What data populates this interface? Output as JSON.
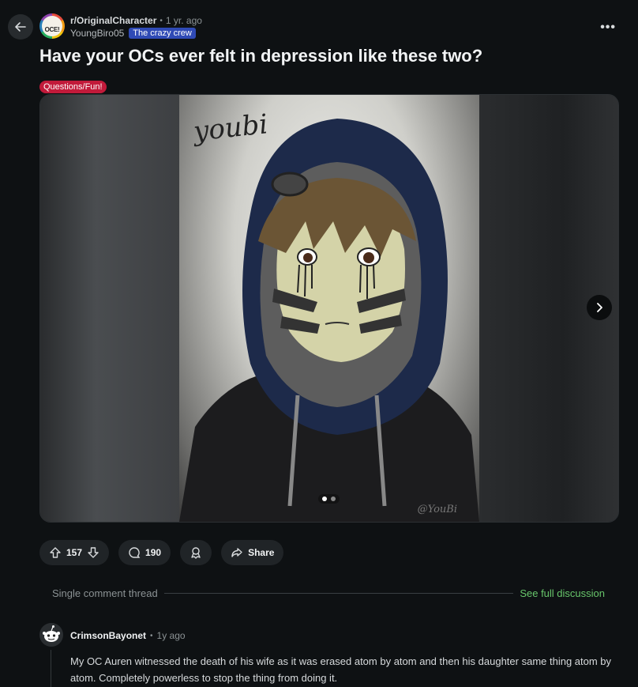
{
  "header": {
    "subreddit": "r/OriginalCharacter",
    "time": "1 yr. ago",
    "author": "YoungBiro05",
    "user_flair": "The crazy crew",
    "subreddit_avatar_text": "OCE!"
  },
  "post": {
    "title": "Have your OCs ever felt in depression like these two?",
    "flair": "Questions/Fun!",
    "media": {
      "signature": "youbi",
      "watermark": "@YouBi",
      "slide_count": 2,
      "active_slide": 1
    }
  },
  "actions": {
    "votes": "157",
    "comments": "190",
    "share_label": "Share"
  },
  "thread": {
    "label": "Single comment thread",
    "full_link": "See full discussion"
  },
  "comment": {
    "author": "CrimsonBayonet",
    "time": "1y ago",
    "body": "My OC Auren witnessed the death of his wife as it was erased atom by atom and then his daughter same thing atom by atom. Completely powerless to stop the thing from doing it."
  },
  "colors": {
    "background": "#0e1113",
    "post_flair": "#c21a3a",
    "user_flair": "#2f4ab5",
    "link_green": "#68c66b"
  }
}
